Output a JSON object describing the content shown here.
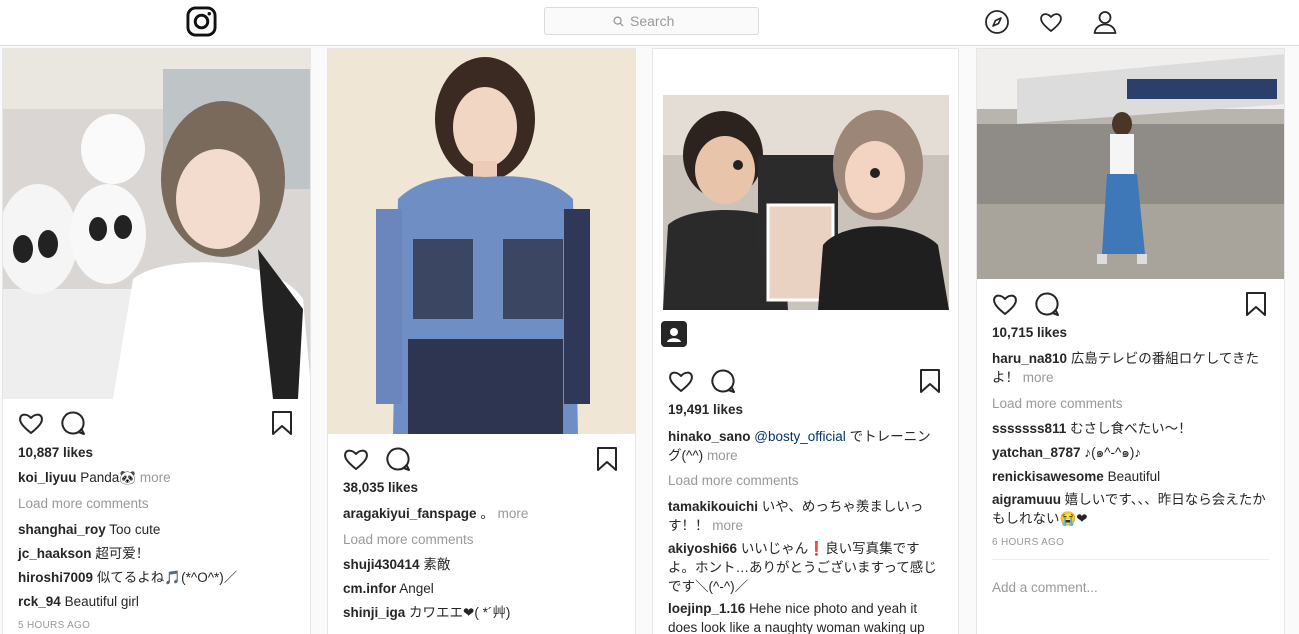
{
  "header": {
    "logo": "instagram-logo",
    "search_placeholder": "Search",
    "icons": [
      "compass-icon",
      "heart-icon",
      "profile-icon"
    ]
  },
  "posts": [
    {
      "likes": "10,887 likes",
      "caption_user": "koi_liyuu",
      "caption_text": "Panda🐼",
      "more": "more",
      "load_more": "Load more comments",
      "comments": [
        {
          "user": "shanghai_roy",
          "text": "Too cute"
        },
        {
          "user": "jc_haakson",
          "text": "超可爱！"
        },
        {
          "user": "hiroshi7009",
          "text": "似てるよね🎵(*^O^*)／"
        },
        {
          "user": "rck_94",
          "text": "Beautiful girl"
        }
      ],
      "time": "5 HOURS AGO"
    },
    {
      "likes": "38,035 likes",
      "caption_user": "aragakiyui_fanspage",
      "caption_text": "。",
      "more": "more",
      "load_more": "Load more comments",
      "comments": [
        {
          "user": "shuji430414",
          "text": "素敵"
        },
        {
          "user": "cm.infor",
          "text": "Angel"
        },
        {
          "user": "shinji_iga",
          "text": "カワエエ❤( *´艸)"
        }
      ]
    },
    {
      "likes": "19,491 likes",
      "caption_user": "hinako_sano",
      "caption_mention": "@bosty_official",
      "caption_text": "でトレーニング(^^)",
      "more": "more",
      "load_more": "Load more comments",
      "comments": [
        {
          "user": "tamakikouichi",
          "text": "いや、めっちゃ羨ましいっす！！",
          "more": "more"
        },
        {
          "user": "akiyoshi66",
          "text": "いいじゃん❗良い写真集ですよ。ホント…ありがとうございますって感じです＼(^-^)／"
        },
        {
          "user": "loejinp_1.16",
          "text": "Hehe nice photo and yeah it does look like a naughty woman waking up"
        }
      ]
    },
    {
      "likes": "10,715 likes",
      "caption_user": "haru_na810",
      "caption_text": "広島テレビの番組ロケしてきたよ！",
      "more": "more",
      "load_more": "Load more comments",
      "comments": [
        {
          "user": "sssssss811",
          "text": "むさし食べたい〜！"
        },
        {
          "user": "yatchan_8787",
          "text": "♪(๑^-^๑)♪"
        },
        {
          "user": "renickisawesome",
          "text": "Beautiful"
        },
        {
          "user": "aigramuuu",
          "text": "嬉しいです、、、昨日なら会えたかもしれない😭❤"
        }
      ],
      "time": "6 HOURS AGO",
      "add_comment": "Add a comment..."
    }
  ],
  "colors": {
    "accent": "#262626",
    "muted": "#999999",
    "mention": "#003569",
    "border": "#dbdbdb"
  }
}
